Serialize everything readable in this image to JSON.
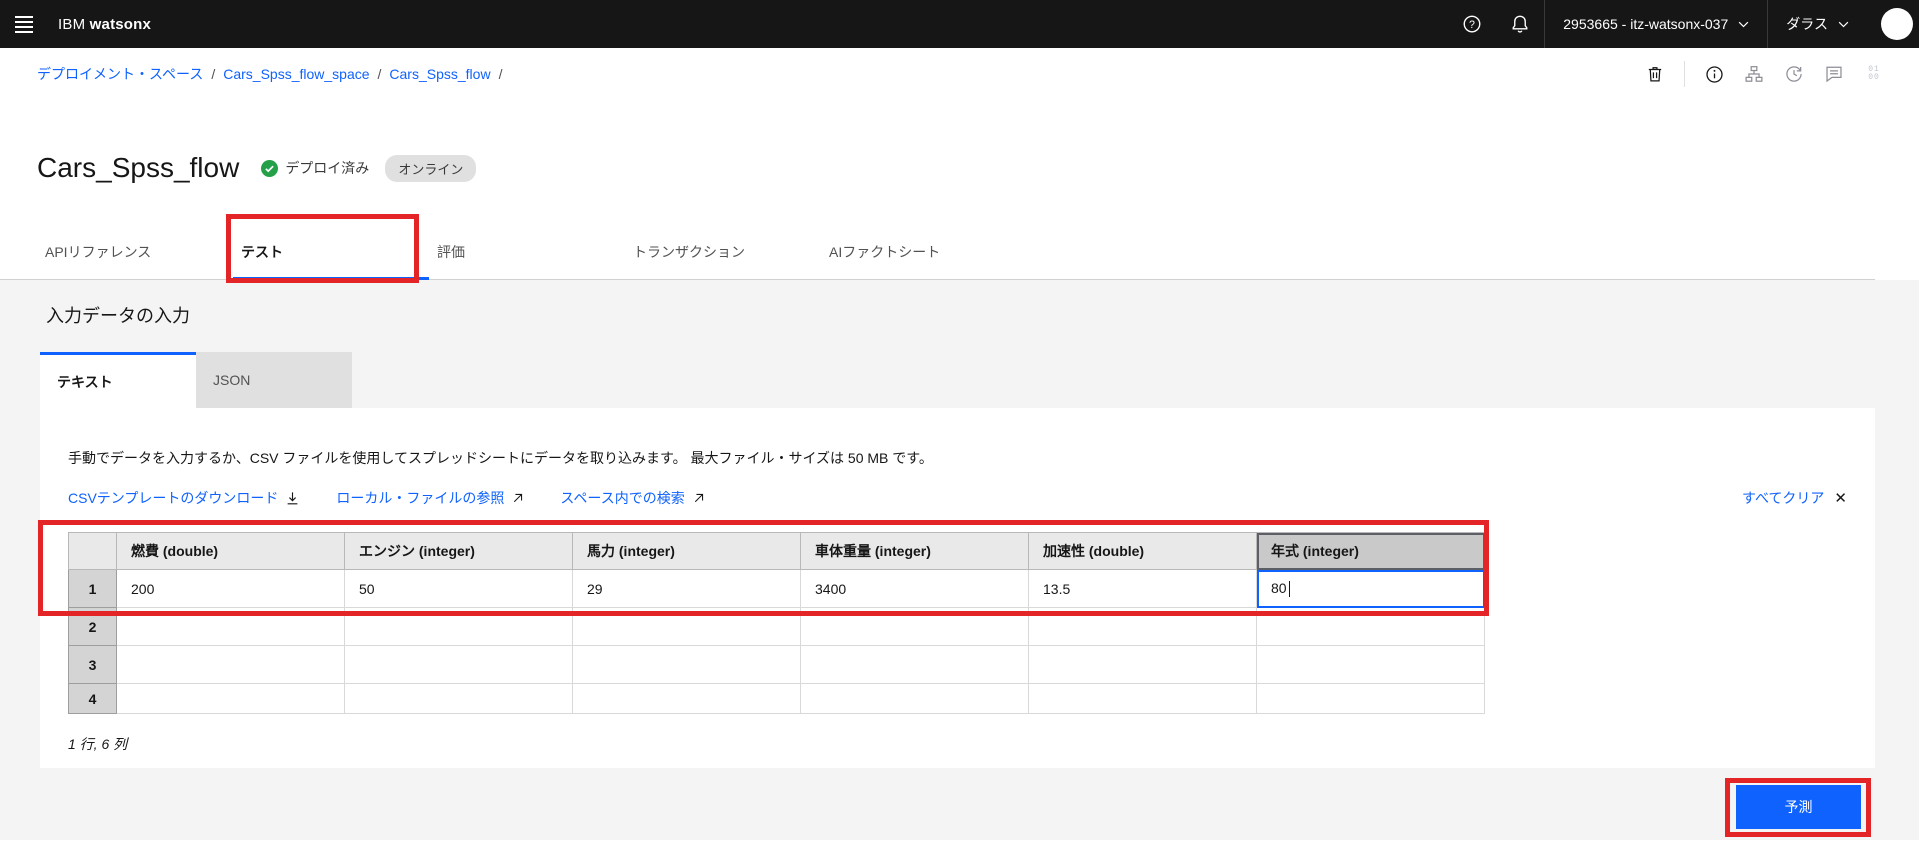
{
  "topbar": {
    "brand_prefix": "IBM",
    "brand_suffix": "watsonx",
    "account": "2953665 - itz-watsonx-037",
    "region": "ダラス"
  },
  "breadcrumb": {
    "items": [
      "デプロイメント・スペース",
      "Cars_Spss_flow_space",
      "Cars_Spss_flow"
    ],
    "separator": "/"
  },
  "page": {
    "title": "Cars_Spss_flow",
    "deploy_status": "デプロイ済み",
    "online_badge": "オンライン"
  },
  "tabs": [
    {
      "label": "APIリファレンス",
      "active": false
    },
    {
      "label": "テスト",
      "active": true
    },
    {
      "label": "評価",
      "active": false
    },
    {
      "label": "トランザクション",
      "active": false
    },
    {
      "label": "AIファクトシート",
      "active": false
    }
  ],
  "input_section": {
    "heading": "入力データの入力",
    "subtabs": [
      {
        "label": "テキスト",
        "active": true
      },
      {
        "label": "JSON",
        "active": false
      }
    ],
    "instruction": "手動でデータを入力するか、CSV ファイルを使用してスプレッドシートにデータを取り込みます。 最大ファイル・サイズは 50 MB です。",
    "links": {
      "download_template": "CSVテンプレートのダウンロード",
      "browse_local": "ローカル・ファイルの参照",
      "search_space": "スペース内での検索",
      "clear_all": "すべてクリア"
    }
  },
  "input_table": {
    "columns": [
      "燃費 (double)",
      "エンジン (integer)",
      "馬力 (integer)",
      "車体重量 (integer)",
      "加速性 (double)",
      "年式 (integer)"
    ],
    "rows": [
      {
        "num": "1",
        "values": [
          "200",
          "50",
          "29",
          "3400",
          "13.5",
          "80"
        ]
      },
      {
        "num": "2",
        "values": [
          "",
          "",
          "",
          "",
          "",
          ""
        ]
      },
      {
        "num": "3",
        "values": [
          "",
          "",
          "",
          "",
          "",
          ""
        ]
      },
      {
        "num": "4",
        "values": [
          "",
          "",
          "",
          "",
          "",
          ""
        ]
      }
    ],
    "summary": "1 行, 6 列",
    "selected_column_index": 5,
    "active_cell": {
      "row": "1",
      "column": "年式 (integer)",
      "value": "80"
    }
  },
  "actions": {
    "predict": "予測"
  },
  "icons": {
    "menu": "hamburger",
    "help": "question-circle",
    "notifications": "bell",
    "account_dropdown": "chevron-down",
    "region_dropdown": "chevron-down",
    "delete": "trash-can",
    "info": "information",
    "promote": "flow",
    "history": "recently-viewed",
    "comments": "chat",
    "data": "binary-01-00",
    "deployed": "check-circle-green",
    "download": "download-arrow",
    "launch": "arrow-up-right",
    "clear": "close-x"
  },
  "colors": {
    "accent": "#0f62fe",
    "annotation_red": "#e32528",
    "success_green": "#24a148",
    "topbar_bg": "#161616",
    "page_bg": "#f4f4f4",
    "badge_bg": "#e0e0e0"
  }
}
